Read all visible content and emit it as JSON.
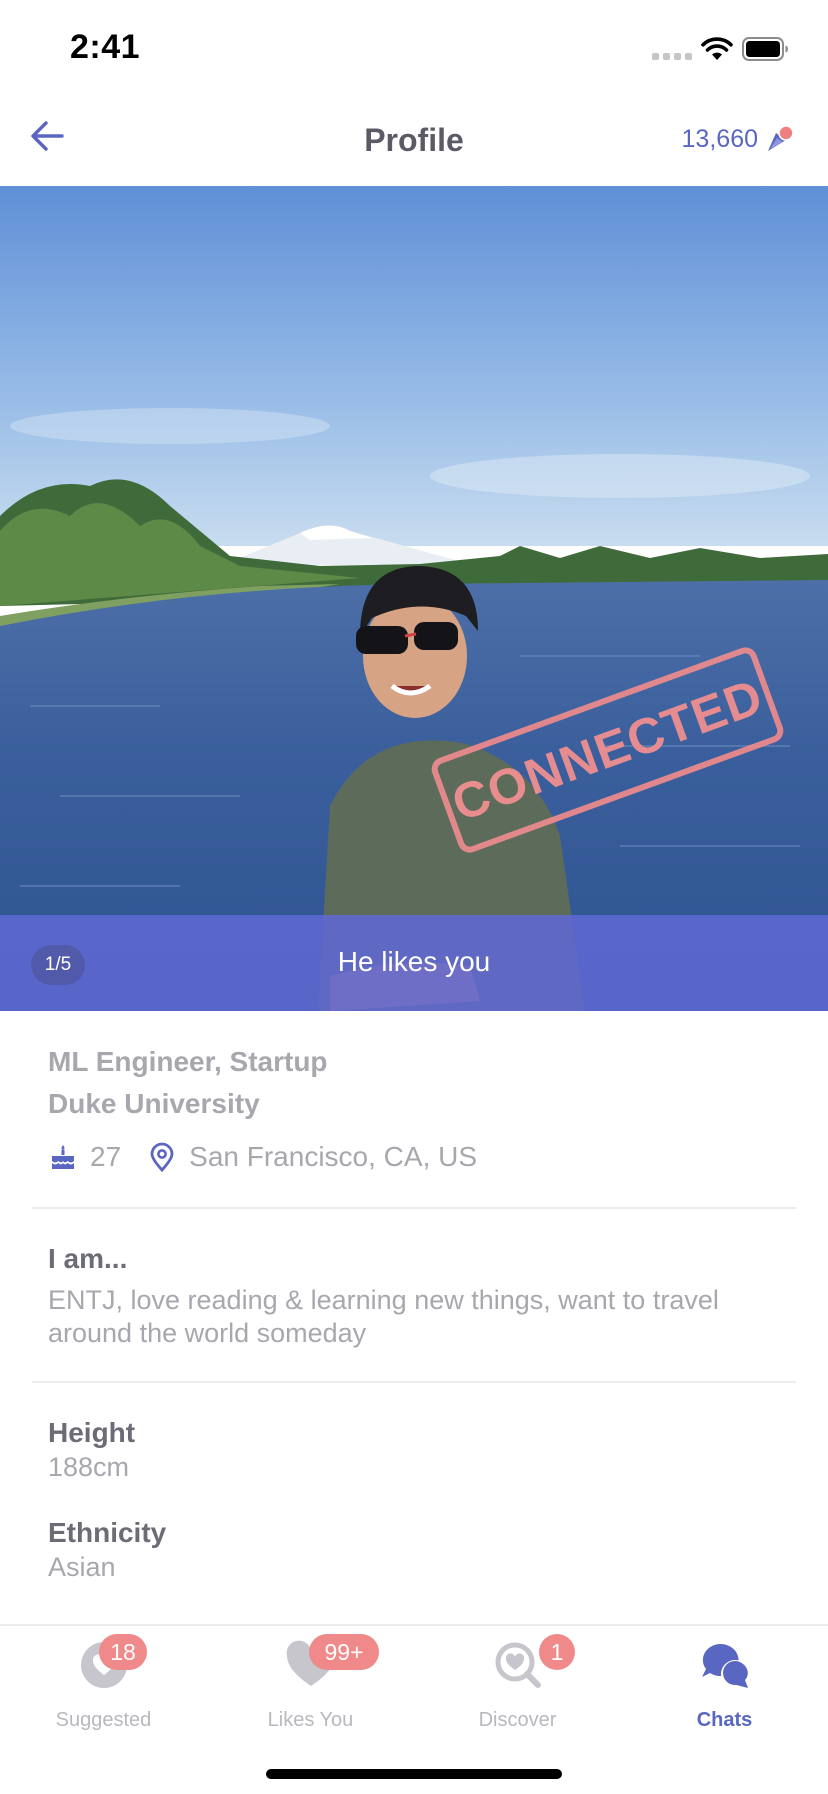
{
  "status_bar": {
    "time": "2:41",
    "icons": [
      "signal-icon",
      "wifi-icon",
      "battery-icon"
    ]
  },
  "header": {
    "title": "Profile",
    "back_icon": "arrow-left-icon",
    "coins": "13,660",
    "coin_icon": "coin-icon"
  },
  "photo": {
    "counter": "1/5",
    "stamp": "CONNECTED",
    "banner_text": "He likes you"
  },
  "profile": {
    "job": "ML Engineer, Startup",
    "school": "Duke University",
    "age_icon": "cake-icon",
    "age": "27",
    "location_icon": "map-pin-icon",
    "location": "San Francisco, CA, US",
    "about_title": "I am...",
    "about_text": "ENTJ, love reading & learning new things, want to travel around the world someday",
    "height_label": "Height",
    "height_value": "188cm",
    "ethnicity_label": "Ethnicity",
    "ethnicity_value": "Asian"
  },
  "tabs": [
    {
      "label": "Suggested",
      "icon": "heart-badge-icon",
      "badge": "18",
      "active": false
    },
    {
      "label": "Likes You",
      "icon": "heart-icon",
      "badge": "99+",
      "active": false
    },
    {
      "label": "Discover",
      "icon": "heart-search-icon",
      "badge": "1",
      "active": false
    },
    {
      "label": "Chats",
      "icon": "chat-bubbles-icon",
      "badge": "",
      "active": true
    }
  ],
  "colors": {
    "accent": "#5966c2",
    "banner": "#6069d4",
    "badge": "#f08a8a",
    "stamp": "#ef8f90",
    "muted_text": "#a7a7ae"
  }
}
